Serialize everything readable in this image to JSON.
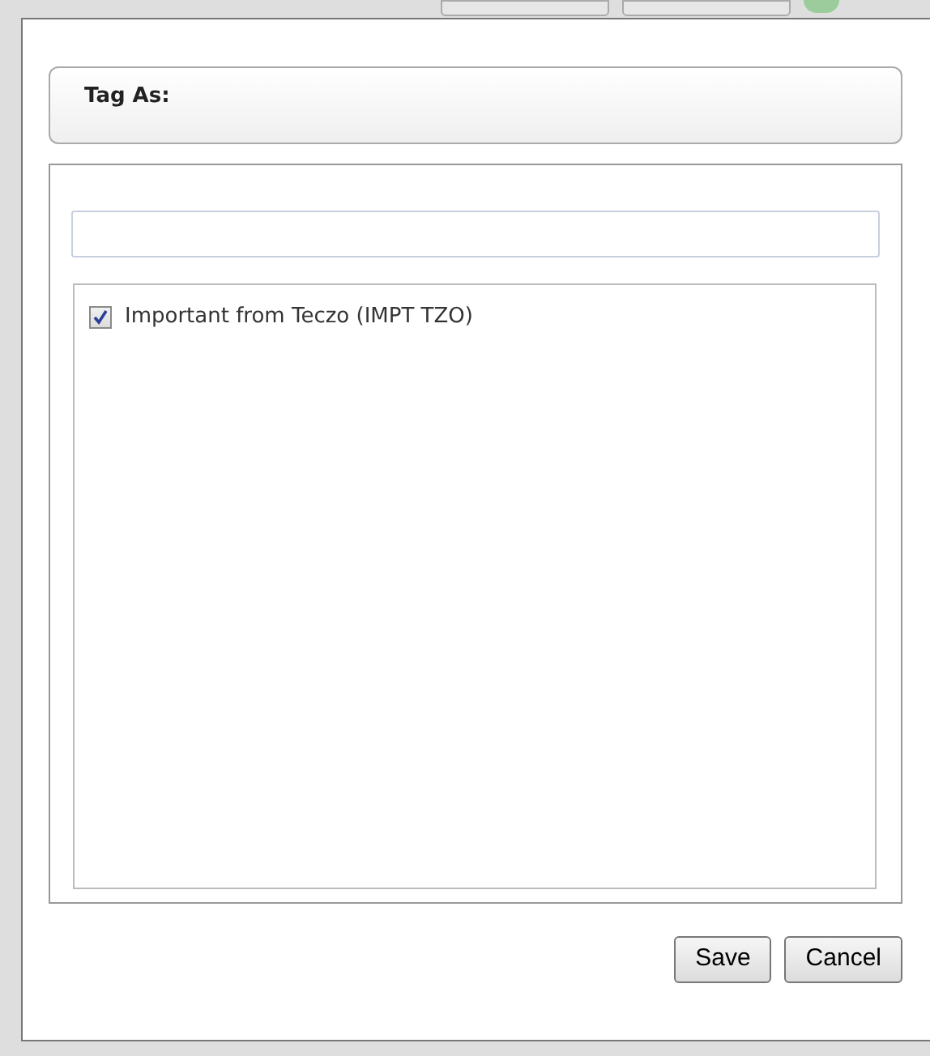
{
  "header": {
    "title": "Tag As:"
  },
  "tags": [
    {
      "label": "Important from Teczo (IMPT TZO)",
      "checked": true
    }
  ],
  "buttons": [
    {
      "label": "Save"
    },
    {
      "label": "Cancel"
    }
  ]
}
